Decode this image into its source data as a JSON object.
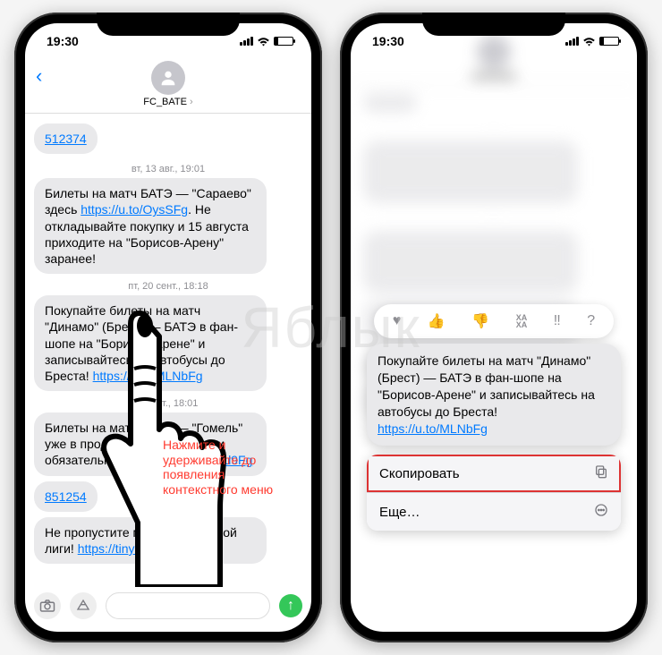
{
  "status": {
    "time": "19:30"
  },
  "header": {
    "sender": "FC_BATE"
  },
  "messages": {
    "link1": "512374",
    "date1": "вт, 13 авг., 19:01",
    "m1_a": "Билеты на матч БАТЭ — \"Сараево\" здесь ",
    "m1_link": "https://u.to/OysSFg",
    "m1_b": ". Не откладывайте покупку и 15 августа приходите на \"Борисов-Арену\" заранее!",
    "date2": "пт, 20 сент., 18:18",
    "m2_a": "Покупайте билеты на матч \"Динамо\" (Брест) — БАТЭ в фан-шопе на \"Борисов-Арене\" и записывайтесь на автобусы до Бреста! ",
    "m2_link": "https://u.to/MLNbFg",
    "date3": "19 окт., 18:01",
    "m3_a": "Билеты на матч БАТЭ — \"Гомель\" уже в продаже! Купите билет и обязательно приходите! ",
    "m3_link": "u.to/r6d9Fg",
    "link2": "851254",
    "m4_a": "Не пропустите матч белорусской лиги! ",
    "m4_link": "https://tinyurl"
  },
  "instruction": "Нажмите и удерживайте до появления контекстного меню",
  "reactions": {
    "heart": "♥",
    "thumbs_up": "👍",
    "thumbs_down": "👎",
    "haha": "ХА\nХА",
    "exclaim": "‼",
    "question": "?"
  },
  "focused": {
    "text_a": "Покупайте билеты на матч \"Динамо\" (Брест) — БАТЭ в фан-шопе на \"Борисов-Арене\" и записывайтесь на автобусы до Бреста! ",
    "link": "https://u.to/MLNbFg"
  },
  "menu": {
    "copy": "Скопировать",
    "more": "Еще…"
  },
  "watermark": "Яблык"
}
